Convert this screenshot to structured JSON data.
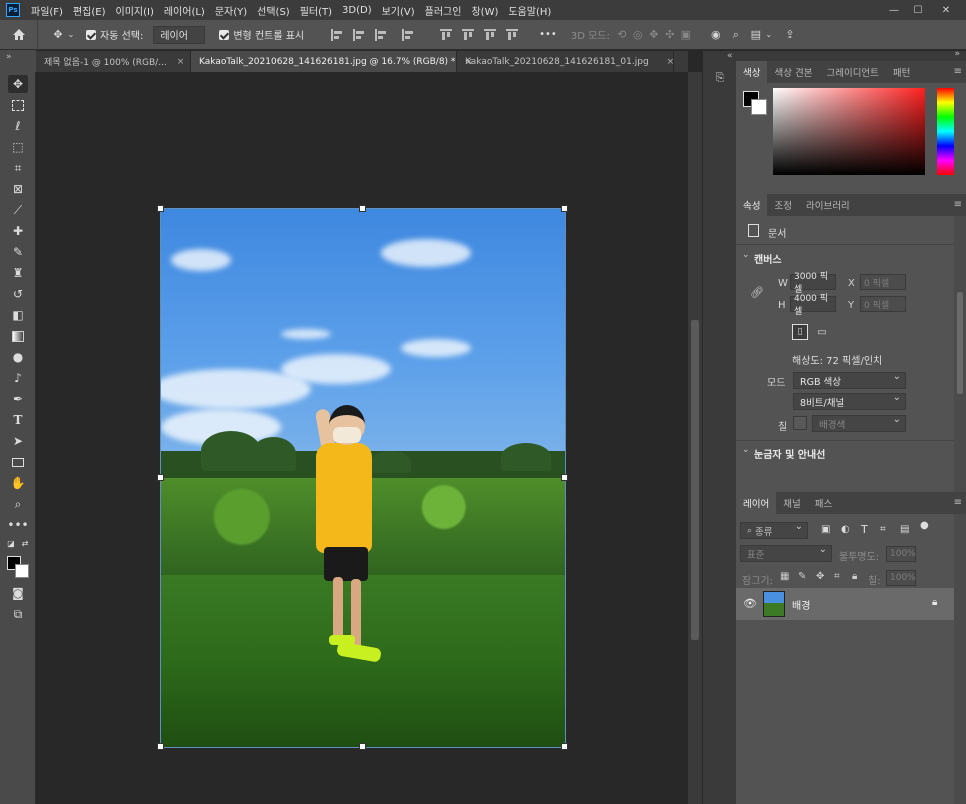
{
  "menu": {
    "items": [
      "파일(F)",
      "편집(E)",
      "이미지(I)",
      "레이어(L)",
      "문자(Y)",
      "선택(S)",
      "필터(T)",
      "3D(D)",
      "보기(V)",
      "플러그인",
      "창(W)",
      "도움말(H)"
    ],
    "logo": "Ps"
  },
  "options": {
    "auto_select_label": "자동 선택:",
    "auto_select_value": "레이어",
    "transform_label": "변형 컨트롤 표시",
    "more": "•••",
    "mode3d_label": "3D 모드:"
  },
  "tabs": [
    {
      "label": "제목 없음-1 @ 100% (RGB/...",
      "close": "×"
    },
    {
      "label": "KakaoTalk_20210628_141626181.jpg @ 16.7% (RGB/8) *",
      "close": "×"
    },
    {
      "label": "KakaoTalk_20210628_141626181_01.jpg",
      "close": "×"
    }
  ],
  "color_panel": {
    "tabs": [
      "색상",
      "색상 견본",
      "그레이디언트",
      "패턴"
    ]
  },
  "properties_panel": {
    "tabs": [
      "속성",
      "조정",
      "라이브러리"
    ],
    "doc_label": "문서",
    "canvas_section": "캔버스",
    "w_label": "W",
    "w_value": "3000 픽셀",
    "h_label": "H",
    "h_value": "4000 픽셀",
    "x_label": "X",
    "x_value": "0 픽셀",
    "y_label": "Y",
    "y_value": "0 픽셀",
    "resolution": "해상도: 72 픽셀/인치",
    "mode_label": "모드",
    "mode_value": "RGB 색상",
    "depth_value": "8비트/채널",
    "fill_label": "칠",
    "fill_value": "배경색",
    "rulers_section": "눈금자 및 안내선"
  },
  "layers_panel": {
    "tabs": [
      "레이어",
      "채널",
      "패스"
    ],
    "filter_label": "종류",
    "blend_value": "표준",
    "opacity_label": "불투명도:",
    "opacity_value": "100%",
    "lock_label": "잠그기:",
    "fill_label": "칠:",
    "fill_value": "100%",
    "layer_name": "배경"
  }
}
